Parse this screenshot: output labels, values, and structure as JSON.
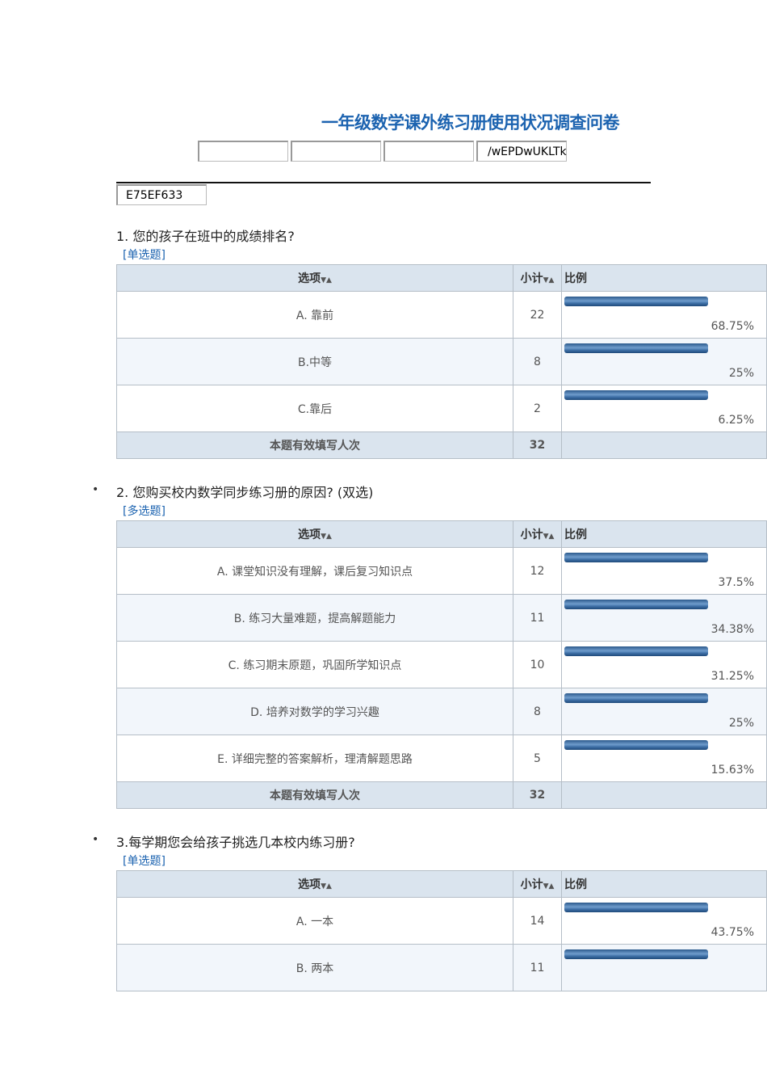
{
  "title": "一年级数学课外练习册使用状况调查问卷",
  "inputs": [
    "",
    "",
    "",
    "/wEPDwUKLTk"
  ],
  "code_input": "E75EF633",
  "headers": {
    "option": "选项",
    "count": "小计",
    "ratio": "比例",
    "sort_icon": "▼▲"
  },
  "footer_label": "本题有效填写人次",
  "questions": [
    {
      "title": "1. 您的孩子在班中的成绩排名?",
      "type": "[单选题]",
      "rows": [
        {
          "option": "A. 靠前",
          "count": "22",
          "pct": "68.75%"
        },
        {
          "option": "B.中等",
          "count": "8",
          "pct": "25%"
        },
        {
          "option": "C.靠后",
          "count": "2",
          "pct": "6.25%"
        }
      ],
      "total": "32"
    },
    {
      "title": "2. 您购买校内数学同步练习册的原因? (双选)",
      "type": "[多选题]",
      "rows": [
        {
          "option": "A. 课堂知识没有理解，课后复习知识点",
          "count": "12",
          "pct": "37.5%"
        },
        {
          "option": "B. 练习大量难题，提高解题能力",
          "count": "11",
          "pct": "34.38%"
        },
        {
          "option": "C. 练习期末原题，巩固所学知识点",
          "count": "10",
          "pct": "31.25%"
        },
        {
          "option": "D. 培养对数学的学习兴趣",
          "count": "8",
          "pct": "25%"
        },
        {
          "option": "E. 详细完整的答案解析，理清解题思路",
          "count": "5",
          "pct": "15.63%"
        }
      ],
      "total": "32"
    },
    {
      "title": "3.每学期您会给孩子挑选几本校内练习册?",
      "type": "[单选题]",
      "rows": [
        {
          "option": "A. 一本",
          "count": "14",
          "pct": "43.75%"
        },
        {
          "option": "B. 两本",
          "count": "11",
          "pct": ""
        }
      ]
    }
  ]
}
